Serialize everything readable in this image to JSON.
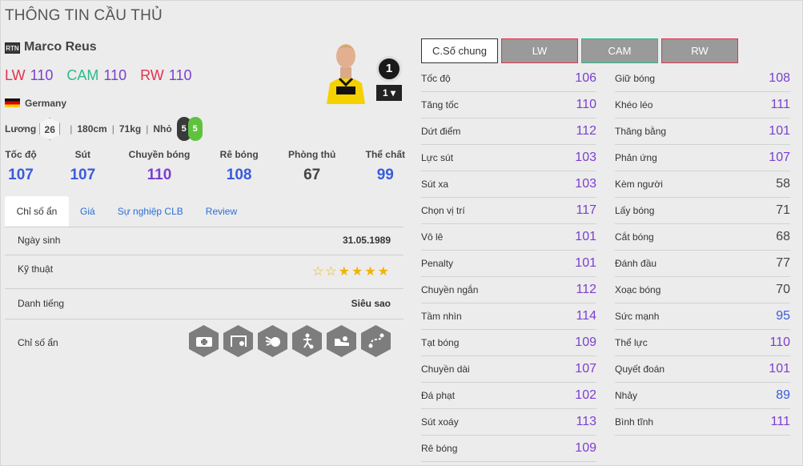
{
  "page_title": "THÔNG TIN CẦU THỦ",
  "player": {
    "season_badge": "RTN",
    "name": "Marco Reus",
    "positions": [
      {
        "pos": "LW",
        "value": "110"
      },
      {
        "pos": "CAM",
        "value": "110"
      },
      {
        "pos": "RW",
        "value": "110"
      }
    ],
    "nation": "Germany",
    "grade": "1",
    "grade_select": "1",
    "salary_label": "Lương",
    "salary": "26",
    "height": "180cm",
    "weight": "71kg",
    "body": "Nhỏ",
    "weak_foot_left": "5",
    "weak_foot_right": "5"
  },
  "main_stats": [
    {
      "label": "Tốc độ",
      "value": "107"
    },
    {
      "label": "Sút",
      "value": "107"
    },
    {
      "label": "Chuyền bóng",
      "value": "110"
    },
    {
      "label": "Rê bóng",
      "value": "108"
    },
    {
      "label": "Phòng thủ",
      "value": "67"
    },
    {
      "label": "Thể chất",
      "value": "99"
    }
  ],
  "tabs": [
    "Chỉ số ẩn",
    "Giá",
    "Sự nghiệp CLB",
    "Review"
  ],
  "info": {
    "birth_label": "Ngày sinh",
    "birth": "31.05.1989",
    "skill_label": "Kỹ thuật",
    "skill_stars": 4,
    "skill_stars_max": 6,
    "reputation_label": "Danh tiếng",
    "reputation": "Siêu sao",
    "hidden_label": "Chỉ số ẩn",
    "traits": [
      "medic-trait-icon",
      "goal-trait-icon",
      "shot-trait-icon",
      "dribble-trait-icon",
      "boot-trait-icon",
      "pass-trait-icon"
    ]
  },
  "position_tabs": [
    "C.Số chung",
    "LW",
    "CAM",
    "RW"
  ],
  "stats_left": [
    {
      "name": "Tốc độ",
      "value": "106"
    },
    {
      "name": "Tăng tốc",
      "value": "110"
    },
    {
      "name": "Dứt điểm",
      "value": "112"
    },
    {
      "name": "Lực sút",
      "value": "103"
    },
    {
      "name": "Sút xa",
      "value": "103"
    },
    {
      "name": "Chọn vị trí",
      "value": "117"
    },
    {
      "name": "Vô lê",
      "value": "101"
    },
    {
      "name": "Penalty",
      "value": "101"
    },
    {
      "name": "Chuyền ngắn",
      "value": "112"
    },
    {
      "name": "Tầm nhìn",
      "value": "114"
    },
    {
      "name": "Tạt bóng",
      "value": "109"
    },
    {
      "name": "Chuyền dài",
      "value": "107"
    },
    {
      "name": "Đá phạt",
      "value": "102"
    },
    {
      "name": "Sút xoáy",
      "value": "113"
    },
    {
      "name": "Rê bóng",
      "value": "109"
    }
  ],
  "stats_right": [
    {
      "name": "Giữ bóng",
      "value": "108"
    },
    {
      "name": "Khéo léo",
      "value": "111"
    },
    {
      "name": "Thăng bằng",
      "value": "101"
    },
    {
      "name": "Phản ứng",
      "value": "107"
    },
    {
      "name": "Kèm người",
      "value": "58"
    },
    {
      "name": "Lấy bóng",
      "value": "71"
    },
    {
      "name": "Cắt bóng",
      "value": "68"
    },
    {
      "name": "Đánh đầu",
      "value": "77"
    },
    {
      "name": "Xoạc bóng",
      "value": "70"
    },
    {
      "name": "Sức mạnh",
      "value": "95"
    },
    {
      "name": "Thể lực",
      "value": "110"
    },
    {
      "name": "Quyết đoán",
      "value": "101"
    },
    {
      "name": "Nhảy",
      "value": "89"
    },
    {
      "name": "Bình tĩnh",
      "value": "111"
    }
  ],
  "colors": {
    "purple": "#7b3fd0",
    "blue": "#3a5bdc",
    "dark": "#444444",
    "red": "#e2334d",
    "green": "#2dbb89",
    "star": "#f0b400"
  }
}
